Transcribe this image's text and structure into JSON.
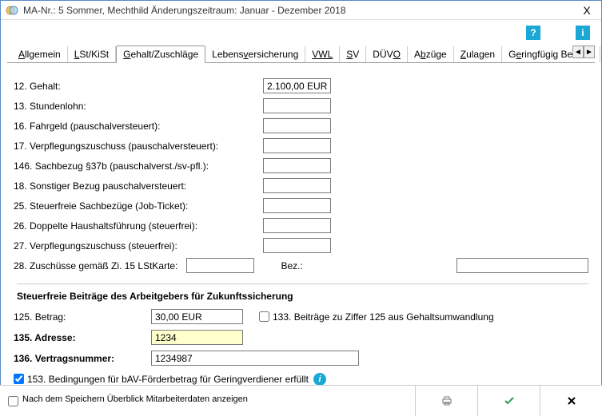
{
  "window": {
    "title": "MA-Nr.:  5 Sommer, Mechthild   Änderungszeitraum: Januar - Dezember 2018",
    "close": "X"
  },
  "help": {
    "q": "?",
    "i": "i"
  },
  "tabs": {
    "t0": "Allgemein",
    "t1": "LSt/KiSt",
    "t2": "Gehalt/Zuschläge",
    "t3": "Lebensversicherung",
    "t4": "VWL",
    "t5": "SV",
    "t6": "DÜVO",
    "t7": "Abzüge",
    "t8": "Zulagen",
    "t9": "Geringfügig Beschä",
    "left": "◄",
    "right": "►"
  },
  "fields": {
    "f12_label": "12. Gehalt:",
    "f12_value": "2.100,00 EUR",
    "f13_label": "13. Stundenlohn:",
    "f13_value": "",
    "f16_label": "16. Fahrgeld (pauschalversteuert):",
    "f16_value": "",
    "f17_label": "17. Verpflegungszuschuss (pauschalversteuert):",
    "f17_value": "",
    "f146_label": "146. Sachbezug §37b (pauschalverst./sv-pfl.):",
    "f146_value": "",
    "f18_label": "18. Sonstiger Bezug pauschalversteuert:",
    "f18_value": "",
    "f25_label": "25. Steuerfreie Sachbezüge (Job-Ticket):",
    "f25_value": "",
    "f26_label": "26. Doppelte Haushaltsführung (steuerfrei):",
    "f26_value": "",
    "f27_label": "27. Verpflegungszuschuss (steuerfrei):",
    "f27_value": "",
    "f28_label": "28. Zuschüsse gemäß Zi. 15 LStKarte:",
    "f28_value": "",
    "bez_label": "Bez.:",
    "bez_value": ""
  },
  "section": {
    "heading": "Steuerfreie Beiträge des Arbeitgebers für Zukunftssicherung",
    "f125_label": "125. Betrag:",
    "f125_value": "30,00 EUR",
    "f133_label": "133. Beiträge zu Ziffer 125 aus Gehaltsumwandlung",
    "f135_label": "135. Adresse:",
    "f135_value": "1234",
    "f136_label": "136. Vertragsnummer:",
    "f136_value": "1234987",
    "f153_label": "153. Bedingungen für bAV-Förderbetrag für Geringverdiener erfüllt"
  },
  "footer": {
    "save_label": "Nach dem Speichern Überblick Mitarbeiterdaten anzeigen"
  }
}
